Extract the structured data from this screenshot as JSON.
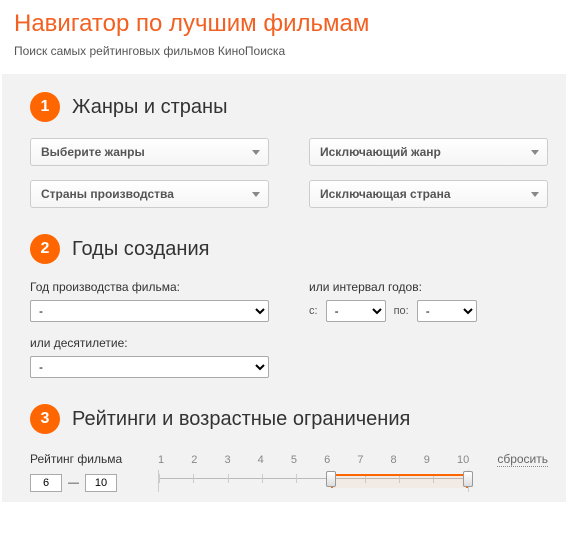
{
  "header": {
    "title": "Навигатор по лучшим фильмам",
    "subtitle": "Поиск самых рейтинговых фильмов КиноПоиска"
  },
  "section1": {
    "num": "1",
    "title": "Жанры и страны",
    "genres_placeholder": "Выберите жанры",
    "exclude_genre_placeholder": "Исключающий жанр",
    "countries_placeholder": "Страны производства",
    "exclude_country_placeholder": "Исключающая страна"
  },
  "section2": {
    "num": "2",
    "title": "Годы создания",
    "year_label": "Год производства фильма:",
    "year_value": "-",
    "interval_label": "или интервал годов:",
    "from_label": "с:",
    "from_value": "-",
    "to_label": "по:",
    "to_value": "-",
    "decade_label": "или десятилетие:",
    "decade_value": "-"
  },
  "section3": {
    "num": "3",
    "title": "Рейтинги и возрастные ограничения",
    "rating_label": "Рейтинг фильма",
    "rating_min": "6",
    "rating_dash": "—",
    "rating_max": "10",
    "ticks": [
      "1",
      "2",
      "3",
      "4",
      "5",
      "6",
      "7",
      "8",
      "9",
      "10"
    ],
    "reset": "сбросить",
    "slider_min_pct": 55.5,
    "slider_max_pct": 100
  }
}
